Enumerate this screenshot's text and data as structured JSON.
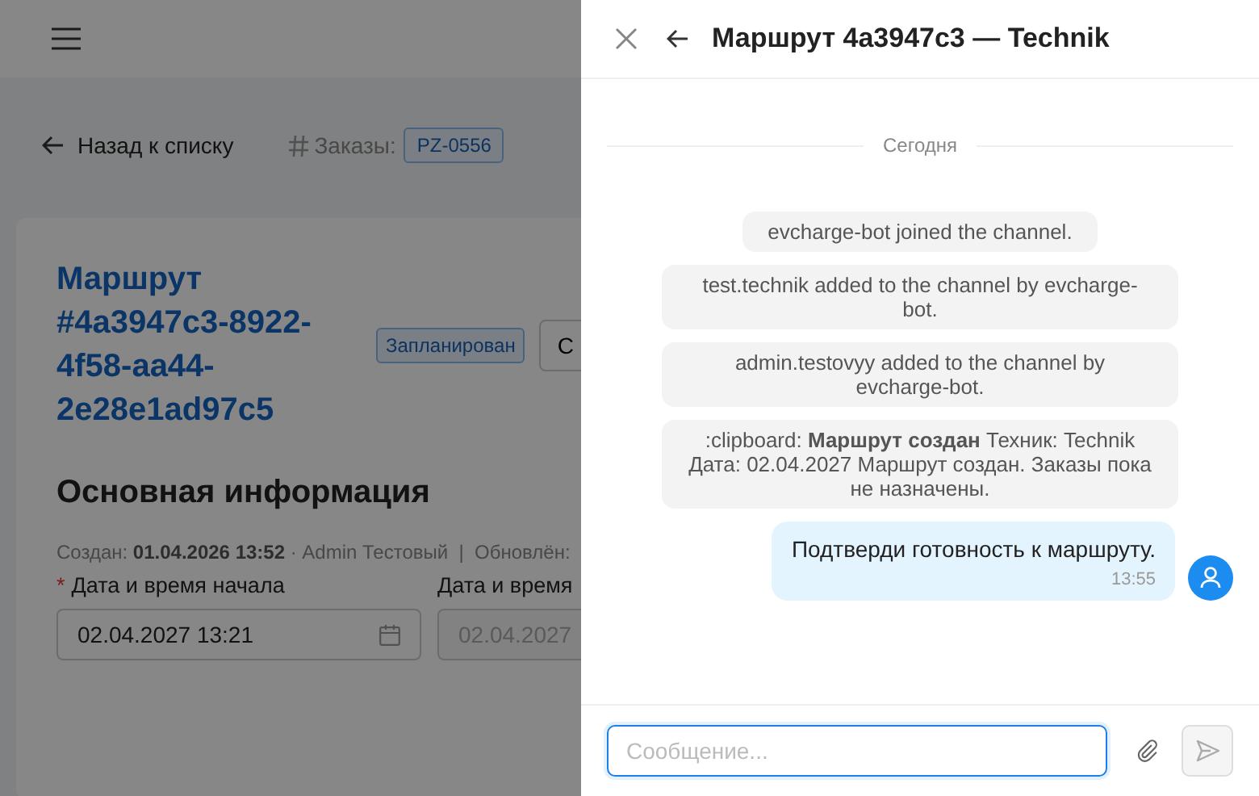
{
  "page": {
    "back_link": "Назад к списку",
    "orders_label": "Заказы:",
    "order_tags": [
      "PZ-0556"
    ],
    "route_title": "Маршрут #4a3947c3-8922-4f58-aa44-2e28e1ad97c5",
    "status_badge": "Запланирован",
    "action_button": "С",
    "section_title": "Основная информация",
    "meta": "Создан: **01.04.2026 13:52** · Admin Тестовый  |  Обновлён:",
    "fields": [
      {
        "label": "Дата и время начала",
        "required_mark": "*",
        "value": "02.04.2027 13:21",
        "disabled": false
      },
      {
        "label": "Дата и время",
        "value": "02.04.2027",
        "disabled": true
      }
    ]
  },
  "chat": {
    "title": "Маршрут 4a3947c3 — Technik",
    "date_divider": "Сегодня",
    "messages": [
      {
        "kind": "system",
        "text": "evcharge-bot joined the channel."
      },
      {
        "kind": "system",
        "text": "test.technik added to the channel by evcharge-bot."
      },
      {
        "kind": "system",
        "text": "admin.testovyy added to the channel by evcharge-bot."
      },
      {
        "kind": "system",
        "text": ":clipboard: **Маршрут создан** Техник: Technik Дата: 02.04.2027 Маршрут создан. Заказы пока не назначены."
      },
      {
        "kind": "own",
        "text": "Подтверди готовность к маршруту.",
        "time": "13:55"
      }
    ],
    "composer": {
      "placeholder": "Сообщение...",
      "send_disabled": true
    }
  }
}
